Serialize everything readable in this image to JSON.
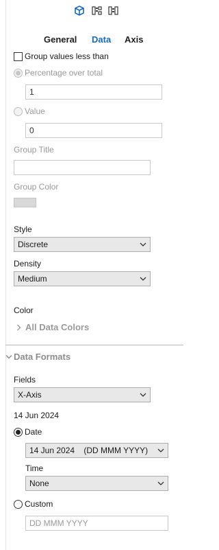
{
  "toolbar": {
    "icons": [
      "cube-icon",
      "chart-series-icon",
      "chart-columns-icon"
    ]
  },
  "tabs": [
    {
      "label": "General",
      "active": false
    },
    {
      "label": "Data",
      "active": true
    },
    {
      "label": "Axis",
      "active": false
    }
  ],
  "grouping": {
    "group_values_label": "Group values less than",
    "group_values_checked": false,
    "percentage_label": "Percentage over total",
    "percentage_value": "1",
    "value_label": "Value",
    "value_value": "0",
    "group_title_label": "Group Title",
    "group_title_value": "",
    "group_color_label": "Group Color"
  },
  "style": {
    "label": "Style",
    "value": "Discrete"
  },
  "density": {
    "label": "Density",
    "value": "Medium"
  },
  "color": {
    "label": "Color",
    "all_data_colors_label": "All Data Colors"
  },
  "data_formats": {
    "section_label": "Data Formats",
    "fields_label": "Fields",
    "fields_value": "X-Axis",
    "preview_text": "14 Jun 2024",
    "date_label": "Date",
    "date_format_value": "14 Jun 2024    (DD MMM YYYY)",
    "time_label": "Time",
    "time_value": "None",
    "custom_label": "Custom",
    "custom_placeholder": "DD MMM YYYY",
    "selected_option": "Date"
  },
  "colors": {
    "accent": "#1769c9",
    "muted_text": "#9a9a9a",
    "select_bg": "#e8e8e8"
  }
}
